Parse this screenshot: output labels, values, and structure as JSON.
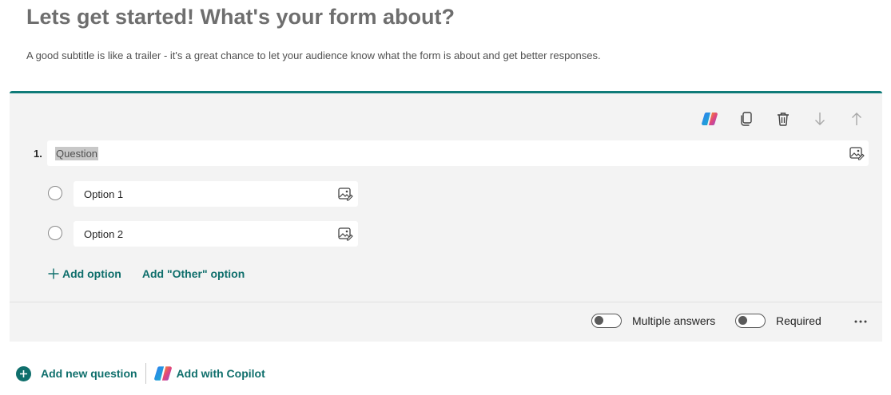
{
  "header": {
    "title": "Lets get started! What's your form about?",
    "subtitle": "A good subtitle is like a trailer - it's a great chance to let your audience know what the form is about and get better responses."
  },
  "question": {
    "number": "1.",
    "text": "Question",
    "options": [
      {
        "label": "Option 1"
      },
      {
        "label": "Option 2"
      }
    ],
    "add_option_label": "Add option",
    "add_other_label": "Add \"Other\" option",
    "multiple_answers_label": "Multiple answers",
    "required_label": "Required",
    "multiple_answers_on": false,
    "required_on": false
  },
  "toolbar": {
    "icons": [
      "copilot-icon",
      "copy-icon",
      "delete-icon",
      "move-down-icon",
      "move-up-icon"
    ]
  },
  "actions": {
    "add_new_question_label": "Add new question",
    "add_with_copilot_label": "Add with Copilot"
  },
  "colors": {
    "accent": "#0f7b78",
    "link": "#0f6f6c",
    "card_bg": "#f3f3f3"
  }
}
